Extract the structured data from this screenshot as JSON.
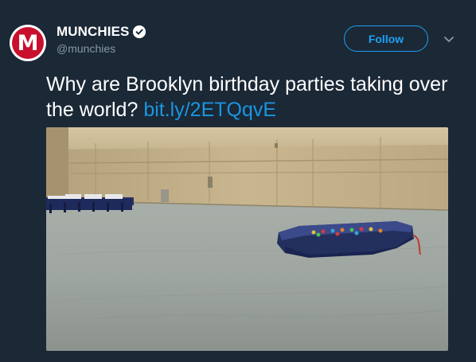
{
  "author": {
    "avatar_letter": "M",
    "display_name": "MUNCHIES",
    "handle": "@munchies",
    "verified": true
  },
  "actions": {
    "follow_label": "Follow",
    "menu_icon": "chevron-down-icon"
  },
  "tweet": {
    "text": "Why are Brooklyn birthday parties taking over the world?",
    "link": "bit.ly/2ETQqvE"
  },
  "colors": {
    "background": "#1b2836",
    "accent": "#1da1f2",
    "link": "#1b95e0",
    "secondary_text": "#8899a6",
    "brand_red": "#c8102e"
  }
}
